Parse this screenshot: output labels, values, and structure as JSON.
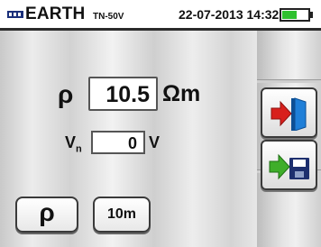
{
  "header": {
    "mode_title": "EARTH",
    "mode_subtitle": "TN-50V",
    "datetime": "22-07-2013 14:32",
    "battery_level": 0.6,
    "battery_color": "#2fc12f",
    "mode_icon": "earth-mode-icon"
  },
  "fields": {
    "resistivity": {
      "label": "ρ",
      "value": "10.5",
      "unit": "Ωm"
    },
    "voltage": {
      "label": "V",
      "label_sub": "n",
      "value": "0",
      "unit": "V"
    }
  },
  "buttons": {
    "rho_label": "ρ",
    "distance_label": "10m"
  },
  "side_icons": [
    {
      "name": "exit-icon",
      "colors": [
        "#d8201c",
        "#1f7fd8"
      ]
    },
    {
      "name": "save-icon",
      "colors": [
        "#3fae2a",
        "#1d2f6e"
      ]
    }
  ]
}
